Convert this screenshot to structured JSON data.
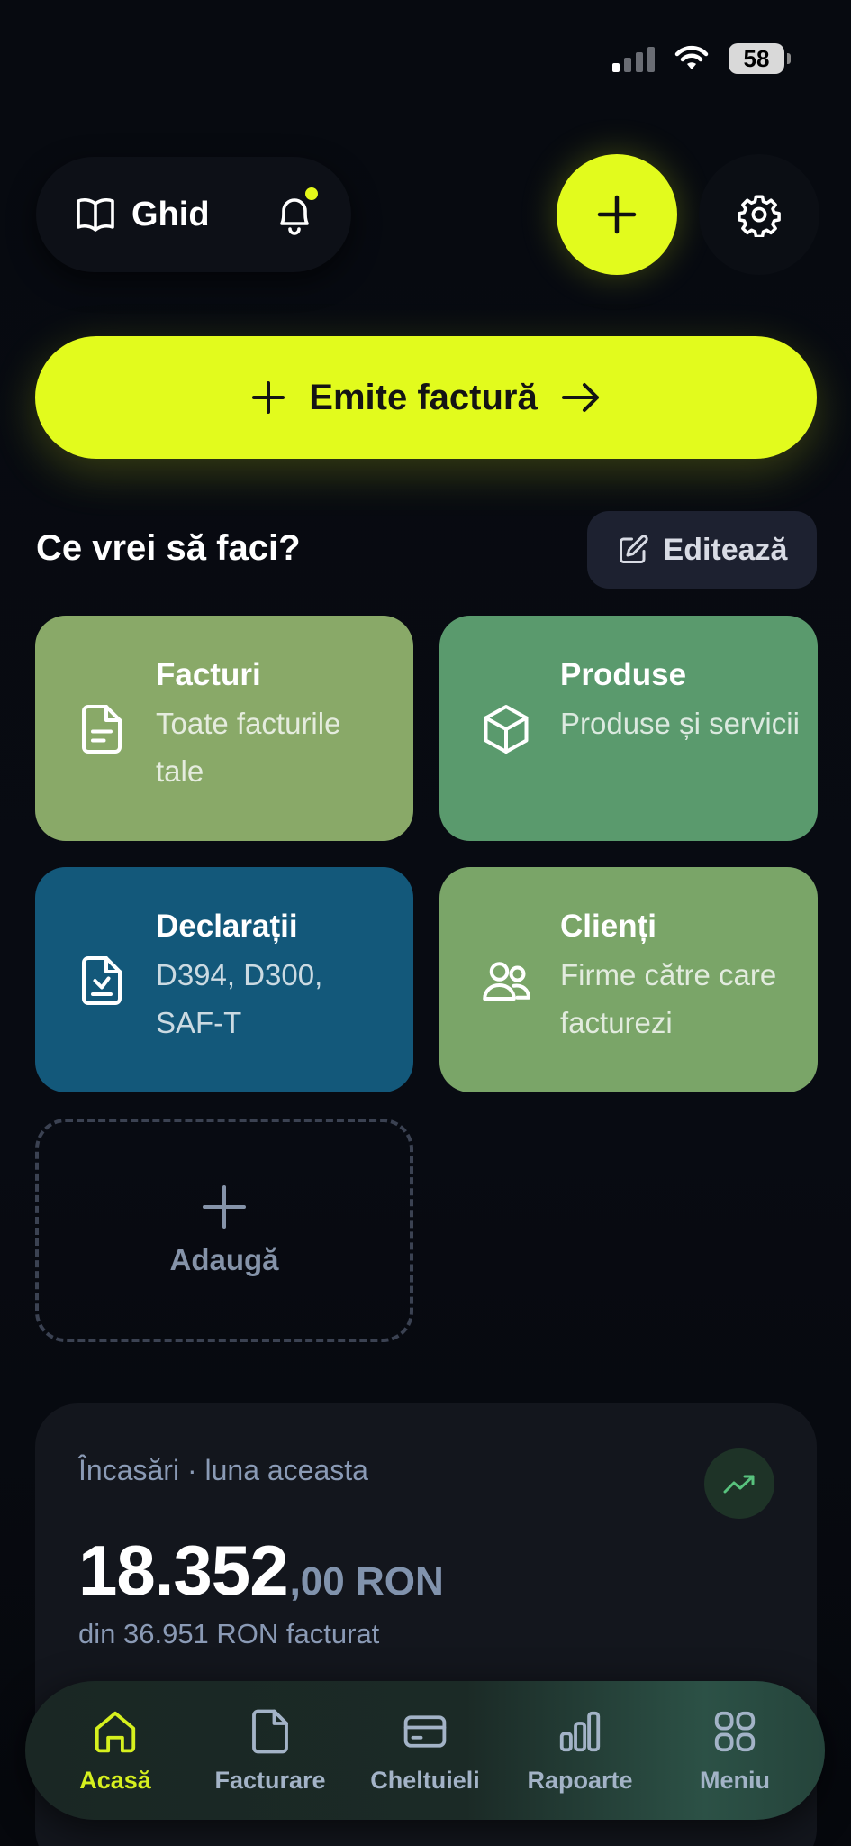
{
  "status_bar": {
    "battery": "58"
  },
  "header": {
    "guide_label": "Ghid"
  },
  "primary_action": {
    "label": "Emite factură"
  },
  "quick_actions": {
    "title": "Ce vrei să faci?",
    "edit_label": "Editează",
    "tiles": [
      {
        "title": "Facturi",
        "subtitle": "Toate facturile tale",
        "icon": "document-icon",
        "color": "#89a968"
      },
      {
        "title": "Produse",
        "subtitle": "Produse și servicii",
        "icon": "box-icon",
        "color": "#5a9a6d"
      },
      {
        "title": "Declarații",
        "subtitle": "D394, D300, SAF-T",
        "icon": "document-download-icon",
        "color": "#13587a"
      },
      {
        "title": "Clienți",
        "subtitle": "Firme către care facturezi",
        "icon": "users-icon",
        "color": "#7aa568"
      }
    ],
    "add_label": "Adaugă"
  },
  "income": {
    "title": "Încasări · luna aceasta",
    "amount_main": "18.352",
    "amount_decimals": ",00 RON",
    "subtitle": "din 36.951 RON facturat"
  },
  "bottom_nav": {
    "items": [
      {
        "label": "Acasă",
        "icon": "home-icon",
        "active": true
      },
      {
        "label": "Facturare",
        "icon": "file-icon",
        "active": false
      },
      {
        "label": "Cheltuieli",
        "icon": "card-icon",
        "active": false
      },
      {
        "label": "Rapoarte",
        "icon": "bar-chart-icon",
        "active": false
      },
      {
        "label": "Meniu",
        "icon": "grid-icon",
        "active": false
      }
    ]
  },
  "colors": {
    "accent": "#e2fb1d",
    "background": "#07090f",
    "card": "#13161d"
  }
}
